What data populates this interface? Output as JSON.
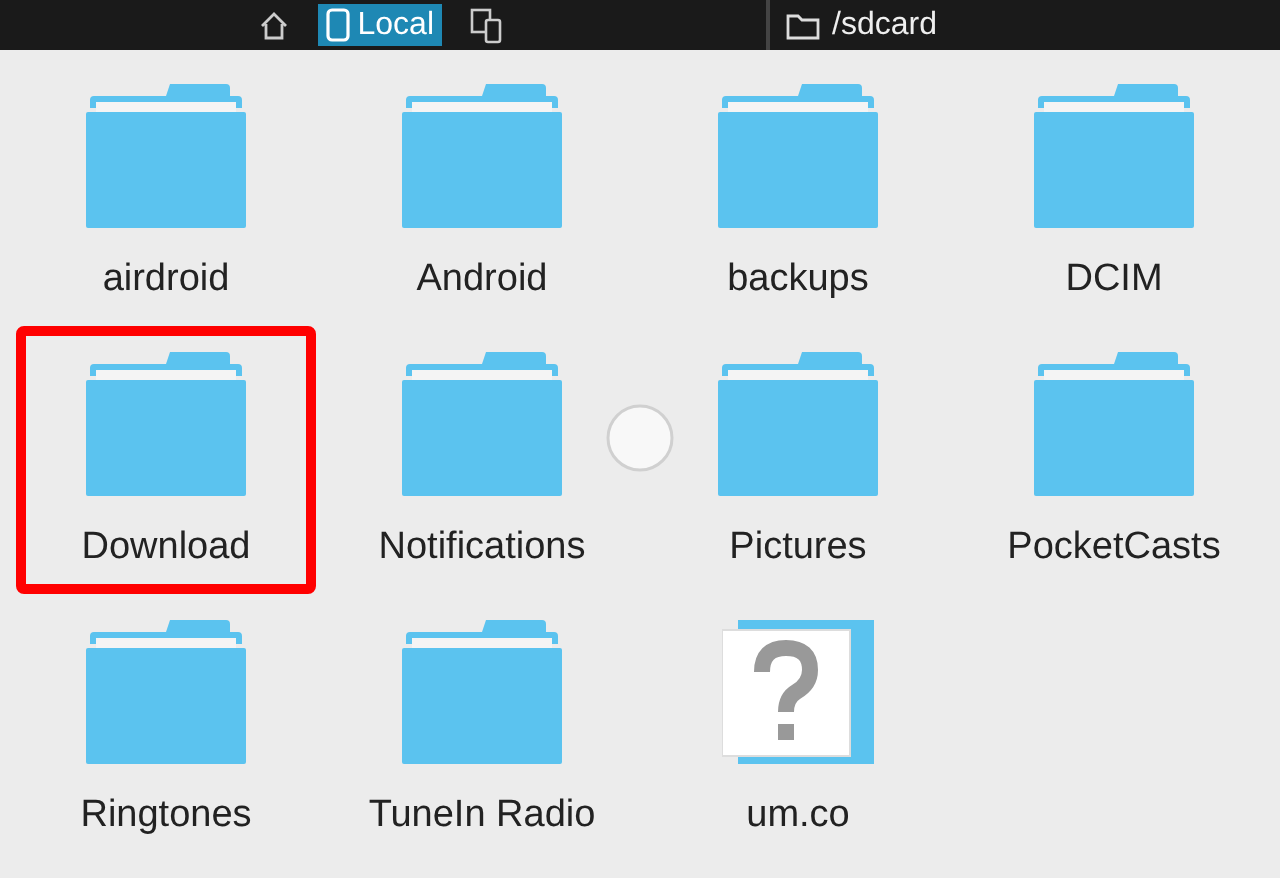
{
  "tabs": [
    {
      "kind": "home",
      "selected": false
    },
    {
      "kind": "phone",
      "label": "Local",
      "selected": true
    },
    {
      "kind": "devices",
      "selected": false
    }
  ],
  "path": {
    "label": "/sdcard"
  },
  "items": [
    {
      "name": "airdroid",
      "kind": "folder",
      "highlighted": false
    },
    {
      "name": "Android",
      "kind": "folder",
      "highlighted": false
    },
    {
      "name": "backups",
      "kind": "folder",
      "highlighted": false
    },
    {
      "name": "DCIM",
      "kind": "folder",
      "highlighted": false
    },
    {
      "name": "Download",
      "kind": "folder",
      "highlighted": true
    },
    {
      "name": "Notifications",
      "kind": "folder",
      "highlighted": false
    },
    {
      "name": "Pictures",
      "kind": "folder",
      "highlighted": false
    },
    {
      "name": "PocketCasts",
      "kind": "folder",
      "highlighted": false
    },
    {
      "name": "Ringtones",
      "kind": "folder",
      "highlighted": false
    },
    {
      "name": "TuneIn Radio",
      "kind": "folder",
      "highlighted": false
    },
    {
      "name": "um.co",
      "kind": "unknown",
      "highlighted": false
    }
  ]
}
